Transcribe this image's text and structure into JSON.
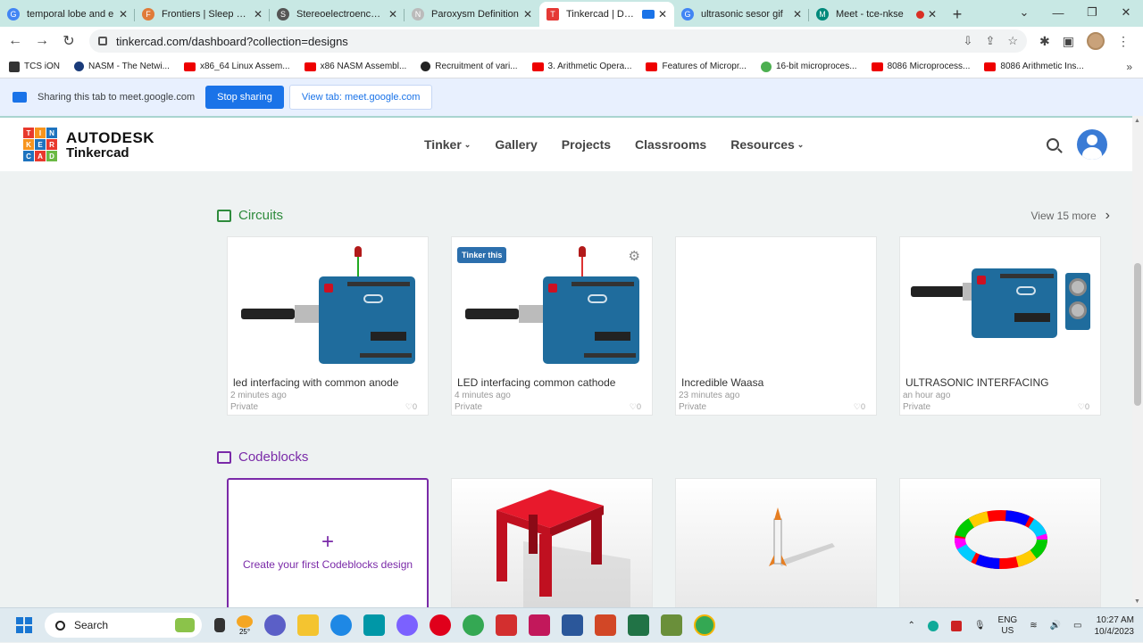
{
  "tabs": [
    {
      "title": "temporal lobe and e",
      "fav_color": "#4285f4",
      "fav_text": "G"
    },
    {
      "title": "Frontiers | Sleep and",
      "fav_color": "#e07b39",
      "fav_text": "F"
    },
    {
      "title": "Stereoelectroenceph",
      "fav_color": "#555555",
      "fav_text": "S"
    },
    {
      "title": "Paroxysm Definition",
      "fav_color": "#cccccc",
      "fav_text": "N"
    },
    {
      "title": "Tinkercad | Dash",
      "fav_color": "#e53935",
      "fav_text": "T"
    },
    {
      "title": "ultrasonic sesor gif",
      "fav_color": "#4285f4",
      "fav_text": "G"
    },
    {
      "title": "Meet - tce-nkse",
      "fav_color": "#00897b",
      "fav_text": "M"
    }
  ],
  "address": {
    "url": "tinkercad.com/dashboard?collection=designs"
  },
  "bookmarks": [
    {
      "label": "TCS iON",
      "kind": "ts"
    },
    {
      "label": "NASM - The Netwi...",
      "kind": "nasm"
    },
    {
      "label": "x86_64 Linux Assem...",
      "kind": "yt"
    },
    {
      "label": "x86 NASM Assembl...",
      "kind": "yt"
    },
    {
      "label": "Recruitment of vari...",
      "kind": "gl"
    },
    {
      "label": "3. Arithmetic Opera...",
      "kind": "yt"
    },
    {
      "label": "Features of Micropr...",
      "kind": "yt"
    },
    {
      "label": "16-bit microproces...",
      "kind": "gr"
    },
    {
      "label": "8086 Microprocess...",
      "kind": "yt"
    },
    {
      "label": "8086 Arithmetic Ins...",
      "kind": "yt"
    }
  ],
  "share": {
    "text": "Sharing this tab to meet.google.com",
    "stop_label": "Stop sharing",
    "view_label": "View tab: meet.google.com"
  },
  "header": {
    "brand_line1": "AUTODESK",
    "brand_line2": "Tinkercad",
    "logo_letters": [
      "T",
      "I",
      "N",
      "K",
      "E",
      "R",
      "C",
      "A",
      "D"
    ],
    "menu": [
      "Tinker",
      "Gallery",
      "Projects",
      "Classrooms",
      "Resources"
    ]
  },
  "circuits": {
    "title": "Circuits",
    "view_more": "View 15 more",
    "badge": "Tinker this",
    "cards": [
      {
        "name": "led interfacing with common anode",
        "time": "2 minutes ago",
        "privacy": "Private",
        "likes": "0"
      },
      {
        "name": "LED interfacing common cathode",
        "time": "4 minutes ago",
        "privacy": "Private",
        "likes": "0"
      },
      {
        "name": "Incredible Waasa",
        "time": "23 minutes ago",
        "privacy": "Private",
        "likes": "0"
      },
      {
        "name": "ULTRASONIC INTERFACING",
        "time": "an hour ago",
        "privacy": "Private",
        "likes": "0"
      }
    ]
  },
  "codeblocks": {
    "title": "Codeblocks",
    "create_text": "Create your first Codeblocks design"
  },
  "taskbar": {
    "search": "Search",
    "weather": "25°",
    "lang1": "ENG",
    "lang2": "US",
    "time": "10:27 AM",
    "date": "10/4/2023"
  },
  "colors": {
    "circuits_green": "#2e8b3c",
    "codeblocks_purple": "#7a2aa8",
    "accent_blue": "#1a73e8"
  }
}
